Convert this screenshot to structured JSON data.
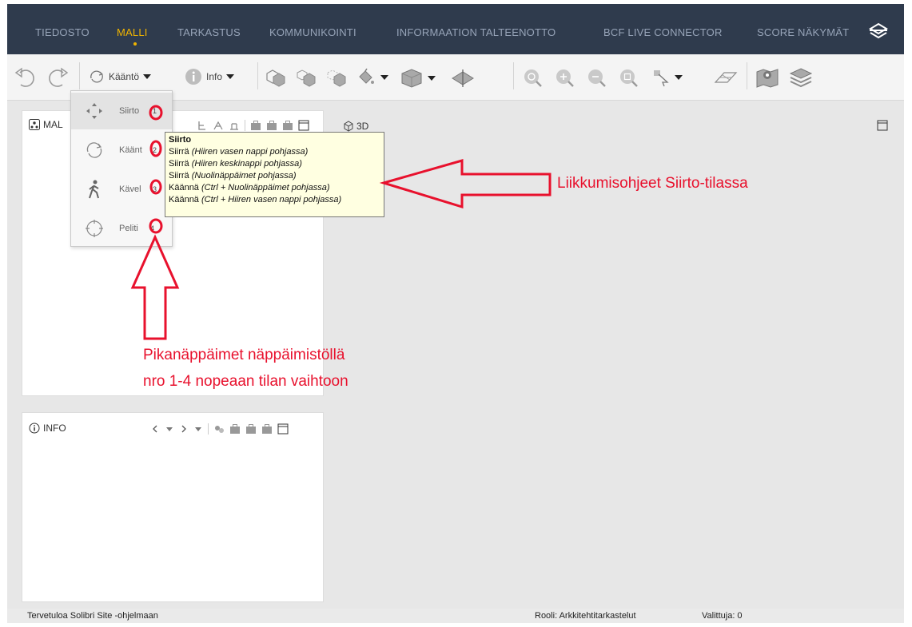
{
  "menubar": {
    "items": [
      "TIEDOSTO",
      "MALLI",
      "TARKASTUS",
      "KOMMUNIKOINTI",
      "INFORMAATION TALTEENOTTO",
      "BCF LIVE CONNECTOR",
      "SCORE NÄKYMÄT"
    ],
    "active_index": 1,
    "icon": "layers-stack-icon"
  },
  "toolbar": {
    "rotate_label": "Kääntö",
    "info_label": "Info"
  },
  "panels": {
    "model_title": "MAL",
    "info_title": "INFO",
    "view3d_title": "3D"
  },
  "mode_menu": {
    "items": [
      {
        "label": "Siirto",
        "shortcut": "1",
        "icon": "move-arrows-icon"
      },
      {
        "label": "Käänt",
        "shortcut": "2",
        "icon": "rotate-icon"
      },
      {
        "label": "Kävel",
        "shortcut": "3",
        "icon": "walk-icon"
      },
      {
        "label": "Peliti",
        "shortcut": "4",
        "icon": "crosshair-icon"
      }
    ]
  },
  "tooltip": {
    "title": "Siirto",
    "lines": [
      {
        "action": "Siirrä",
        "detail": "(Hiiren vasen nappi pohjassa)"
      },
      {
        "action": "Siirrä",
        "detail": "(Hiiren keskinappi pohjassa)"
      },
      {
        "action": "Siirrä",
        "detail": "(Nuolinäppäimet pohjassa)"
      },
      {
        "action": "Käännä",
        "detail": "(Ctrl + Nuolinäppäimet pohjassa)"
      },
      {
        "action": "Käännä",
        "detail": "(Ctrl + Hiiren vasen nappi pohjassa)"
      }
    ]
  },
  "annotations": {
    "right_text": "Liikkumisohjeet Siirto-tilassa",
    "bottom_line1": "Pikanäppäimet näppäimistöllä",
    "bottom_line2": "nro 1-4 nopeaan tilan vaihtoon",
    "color": "#e8112d"
  },
  "statusbar": {
    "welcome": "Tervetuloa Solibri Site -ohjelmaan",
    "role": "Rooli: Arkkitehtitarkastelut",
    "selected": "Valittuja: 0"
  }
}
